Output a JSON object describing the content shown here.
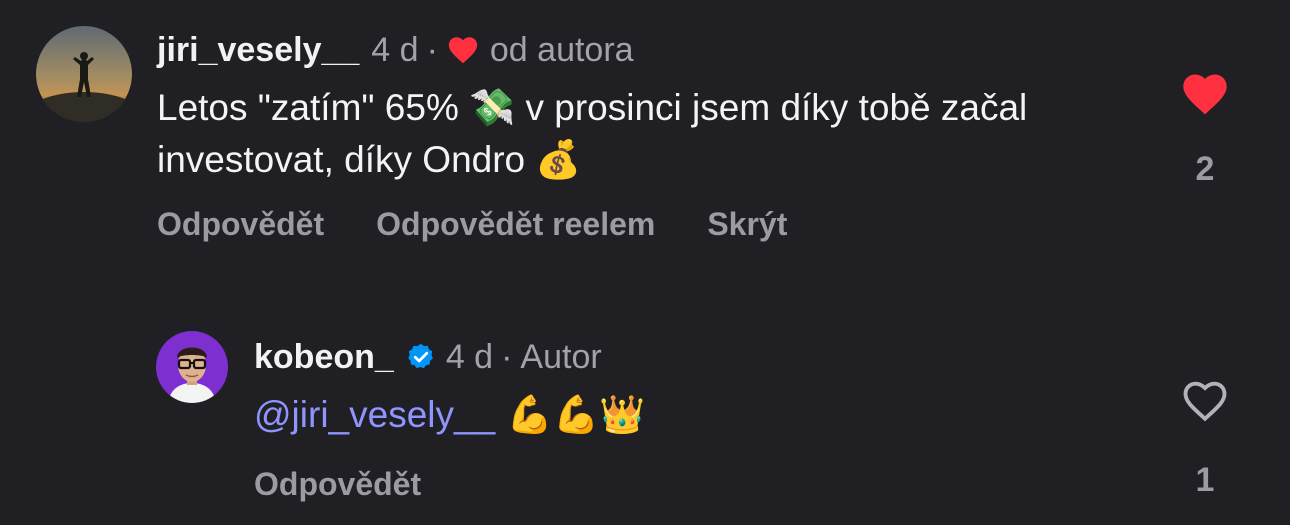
{
  "comments": [
    {
      "username": "jiri_vesely__",
      "time": "4 d",
      "separator": "·",
      "creator_liked": "od autora",
      "text_part1": "Letos \"zatím\" 65% ",
      "emoji1": "💸",
      "text_part2": " v prosinci jsem díky tobě začal investovat, díky Ondro ",
      "emoji2": "💰",
      "actions": {
        "reply": "Odpovědět",
        "reply_reel": "Odpovědět reelem",
        "hide": "Skrýt"
      },
      "likes": "2",
      "liked": true
    },
    {
      "username": "kobeon_",
      "time": "4 d",
      "separator": "·",
      "role": "Autor",
      "mention": "@jiri_vesely__",
      "emojis": " 💪💪👑",
      "actions": {
        "reply": "Odpovědět"
      },
      "likes": "1",
      "liked": false
    }
  ],
  "colors": {
    "background": "#1f1f24",
    "like_red": "#ff3040",
    "mention_blue": "#8f95ff",
    "verified_blue": "#0095f6"
  }
}
